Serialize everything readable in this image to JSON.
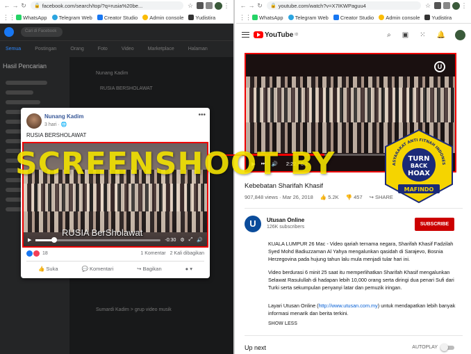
{
  "left_browser": {
    "url": "facebook.com/search/top/?q=rusia%20be...",
    "bookmarks": [
      "WhatsApp",
      "Telegram Web",
      "Creator Studio",
      "Admin console",
      "Yudistira"
    ]
  },
  "facebook_bg": {
    "search_text": "Cari di Facebook",
    "tabs": [
      "Semua",
      "Postingan",
      "Orang",
      "Foto",
      "Video",
      "Marketplace",
      "Halaman"
    ],
    "sidebar_title": "Hasil Pencarian",
    "bg_author": "Nunang Kadim",
    "bg_post_text": "RUSIA BERSHOLAWAT",
    "bg_author_2": "Sumardi Kadim > grup video musik"
  },
  "fb_post": {
    "author": "Nunang Kadim",
    "time": "3 hari · ",
    "text": "RUSIA BERSHOLAWAT",
    "video_caption": "RUSIA BerSholawat",
    "video_time": "-0:30",
    "reaction_count": "18",
    "comments": "1 Komentar",
    "shares": "2 Kali dibagikan",
    "like_label": "Suka",
    "comment_label": "Komentari",
    "share_label": "Bagikan",
    "progress": 0.15
  },
  "right_browser": {
    "url": "youtube.com/watch?v=X7IKWPaguu4",
    "bookmarks": [
      "WhatsApp",
      "Telegram Web",
      "Creator Studio",
      "Admin console",
      "Yudistira"
    ]
  },
  "youtube": {
    "logo": "YouTube",
    "logo_sup": "ID",
    "video_time": "2:22 / 6:2",
    "title": "Kebebatan Sharifah Khasif",
    "views": "907,848 views · Mar 26, 2018",
    "likes": "5.2K",
    "dislikes": "457",
    "share": "SHARE",
    "channel_name": "Utusan Online",
    "channel_initial": "U",
    "subscribers": "126K subscribers",
    "subscribe_label": "SUBSCRIBE",
    "desc_1": "KUALA LUMPUR 26 Mac - Video qariah ternama negara, Sharifah Khasif Fadzilah Syed Mohd Badiuzzaman Al Yahya mengalunkan qasidah di Sarajevo, Bosnia Herzegovina pada hujung tahun lalu mula menjadi tular hari ini.",
    "desc_2": "Video berdurasi 6 minit 25 saat itu memperlihatkan Sharifah Khasif mengalunkan Selawat Rasulullah di hadapan lebih 10,000 orang serta diringi dua penari Sufi dari Turki serta sekumpulan penyanyi latar dan pemuzik iringan.",
    "desc_3_pre": "Layari Utusan Online (",
    "desc_3_link": "http://www.utusan.com.my",
    "desc_3_post": ") untuk mendapatkan lebih banyak informasi menarik dan berita terkini.",
    "show_less": "SHOW LESS",
    "up_next": "Up next",
    "autoplay": "AUTOPLAY",
    "progress": 0.37
  },
  "overlay": {
    "watermark": "SCREENSHOOT BY",
    "badge_ring": "MASYARAKAT ANTI FITNAH INDONESIA",
    "badge_line1": "TURN",
    "badge_line2": "BACK",
    "badge_line3": "HOAX",
    "badge_ribbon": "MAFINDO"
  },
  "colors": {
    "fb_blue": "#385898",
    "yt_red": "#cc0000",
    "highlight_red": "#ee0000",
    "watermark_yellow": "#f2e200",
    "badge_yellow": "#f5d400",
    "badge_blue": "#1b2a78"
  }
}
